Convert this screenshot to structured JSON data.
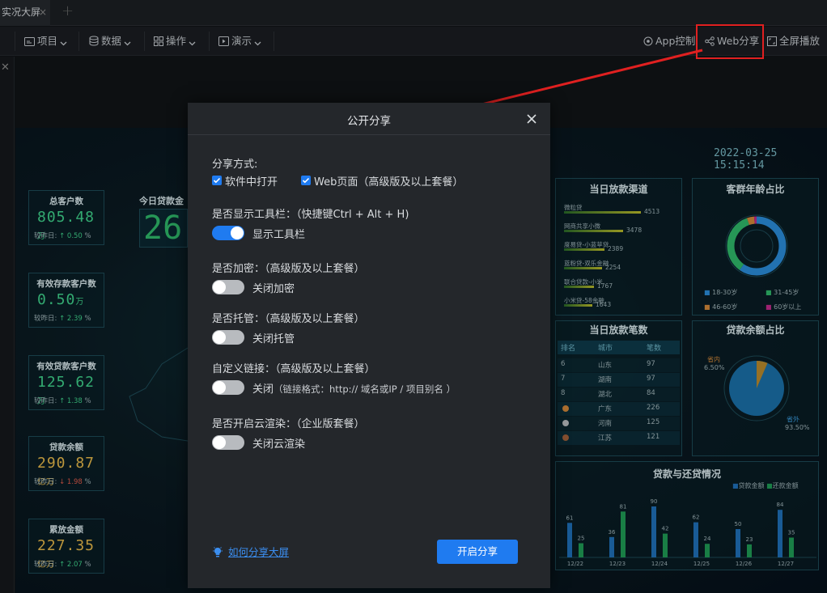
{
  "tab": {
    "title": "实况大屏",
    "close": "×",
    "add": "+"
  },
  "toolbar": {
    "items": [
      {
        "label": "项目",
        "icon": "folder-icon"
      },
      {
        "label": "数据",
        "icon": "database-icon"
      },
      {
        "label": "操作",
        "icon": "grid-icon"
      },
      {
        "label": "演示",
        "icon": "presentation-icon"
      }
    ],
    "right": [
      {
        "label": "App控制",
        "icon": "app-control-icon"
      },
      {
        "label": "Web分享",
        "icon": "share-icon"
      },
      {
        "label": "全屏播放",
        "icon": "fullscreen-icon"
      }
    ]
  },
  "annotation": {
    "color": "#e02020"
  },
  "dashboard": {
    "datetime": "2022-03-25 15:15:14",
    "today_loan_title": "今日贷款金",
    "today_loan_digits": "26",
    "kpis": [
      {
        "title": "总客户数",
        "value": "805.48",
        "unit": "万",
        "sub_label": "较昨日:",
        "change": "0.50",
        "pct": "%",
        "dir": "up",
        "color": "#3fd08a"
      },
      {
        "title": "有效存款客户数",
        "value": "0.50",
        "unit": "万",
        "sub_label": "较昨日:",
        "change": "2.39",
        "pct": "%",
        "dir": "up",
        "color": "#3fd08a"
      },
      {
        "title": "有效贷款客户数",
        "value": "125.62",
        "unit": "万",
        "sub_label": "较昨日:",
        "change": "1.38",
        "pct": "%",
        "dir": "up",
        "color": "#3fd08a"
      },
      {
        "title": "贷款余额",
        "value": "290.87",
        "unit": "亿万",
        "sub_label": "较昨日:",
        "change": "1.98",
        "pct": "%",
        "dir": "down",
        "color": "#e6b84a"
      },
      {
        "title": "累放金额",
        "value": "227.35",
        "unit": "亿万",
        "sub_label": "较昨日:",
        "change": "2.07",
        "pct": "%",
        "dir": "up",
        "color": "#e6b84a"
      }
    ],
    "channels": {
      "title": "当日放款渠道",
      "items": [
        {
          "name": "微粒贷",
          "value": 4513
        },
        {
          "name": "网商共享小微",
          "value": 3478
        },
        {
          "name": "度易贷-小蓝苹贷",
          "value": 2389
        },
        {
          "name": "蓝粉贷-双乐金融",
          "value": 2254
        },
        {
          "name": "联合贷款-小米",
          "value": 1767
        },
        {
          "name": "小米贷-58金融",
          "value": 1643
        }
      ]
    },
    "age": {
      "title": "客群年龄占比",
      "legend": [
        "18-30岁",
        "31-45岁",
        "46-60岁",
        "60岁以上"
      ],
      "colors": [
        "#2a8bd8",
        "#2fb86a",
        "#d2883a",
        "#c02a8a"
      ]
    },
    "count_table": {
      "title": "当日放款笔数",
      "headers": [
        "排名",
        "城市",
        "笔数"
      ],
      "rows": [
        [
          "6",
          "山东",
          "97"
        ],
        [
          "7",
          "湖南",
          "97"
        ],
        [
          "8",
          "湖北",
          "84"
        ],
        [
          "",
          "广东",
          "226"
        ],
        [
          "",
          "河南",
          "125"
        ],
        [
          "",
          "江苏",
          "121"
        ]
      ]
    },
    "balance": {
      "title": "贷款余额占比",
      "slices": [
        {
          "label": "省内",
          "pct": "6.50%",
          "value": 6.5
        },
        {
          "label": "省外",
          "pct": "93.50%",
          "value": 93.5
        }
      ]
    }
  },
  "chart_data": {
    "type": "bar",
    "title": "贷款与还贷情况",
    "categories": [
      "12/22",
      "12/23",
      "12/24",
      "12/25",
      "12/26",
      "12/27"
    ],
    "series": [
      {
        "name": "贷款金额",
        "values": [
          61,
          36,
          90,
          62,
          50,
          84
        ],
        "color": "#1f6fb8"
      },
      {
        "name": "还款金额",
        "values": [
          25,
          81,
          42,
          24,
          23,
          35
        ],
        "color": "#1f9a55"
      }
    ],
    "ylim": [
      0,
      100
    ]
  },
  "dialog": {
    "title": "公开分享",
    "share_method_label": "分享方式:",
    "option_software": "软件中打开",
    "option_web": "Web页面（高级版及以上套餐）",
    "toolbar_label": "是否显示工具栏：（快捷键Ctrl + Alt + H)",
    "toolbar_toggle": "显示工具栏",
    "encrypt_label": "是否加密：（高级版及以上套餐）",
    "encrypt_toggle": "关闭加密",
    "host_label": "是否托管：（高级版及以上套餐）",
    "host_toggle": "关闭托管",
    "custom_link_label": "自定义链接：（高级版及以上套餐）",
    "custom_link_toggle": "关闭",
    "custom_link_hint": "（链接格式：http:// 域名或IP / 项目别名 ）",
    "cloud_label": "是否开启云渲染：（企业版套餐）",
    "cloud_toggle": "关闭云渲染",
    "help_link": "如何分享大屏",
    "start_button": "开启分享"
  }
}
